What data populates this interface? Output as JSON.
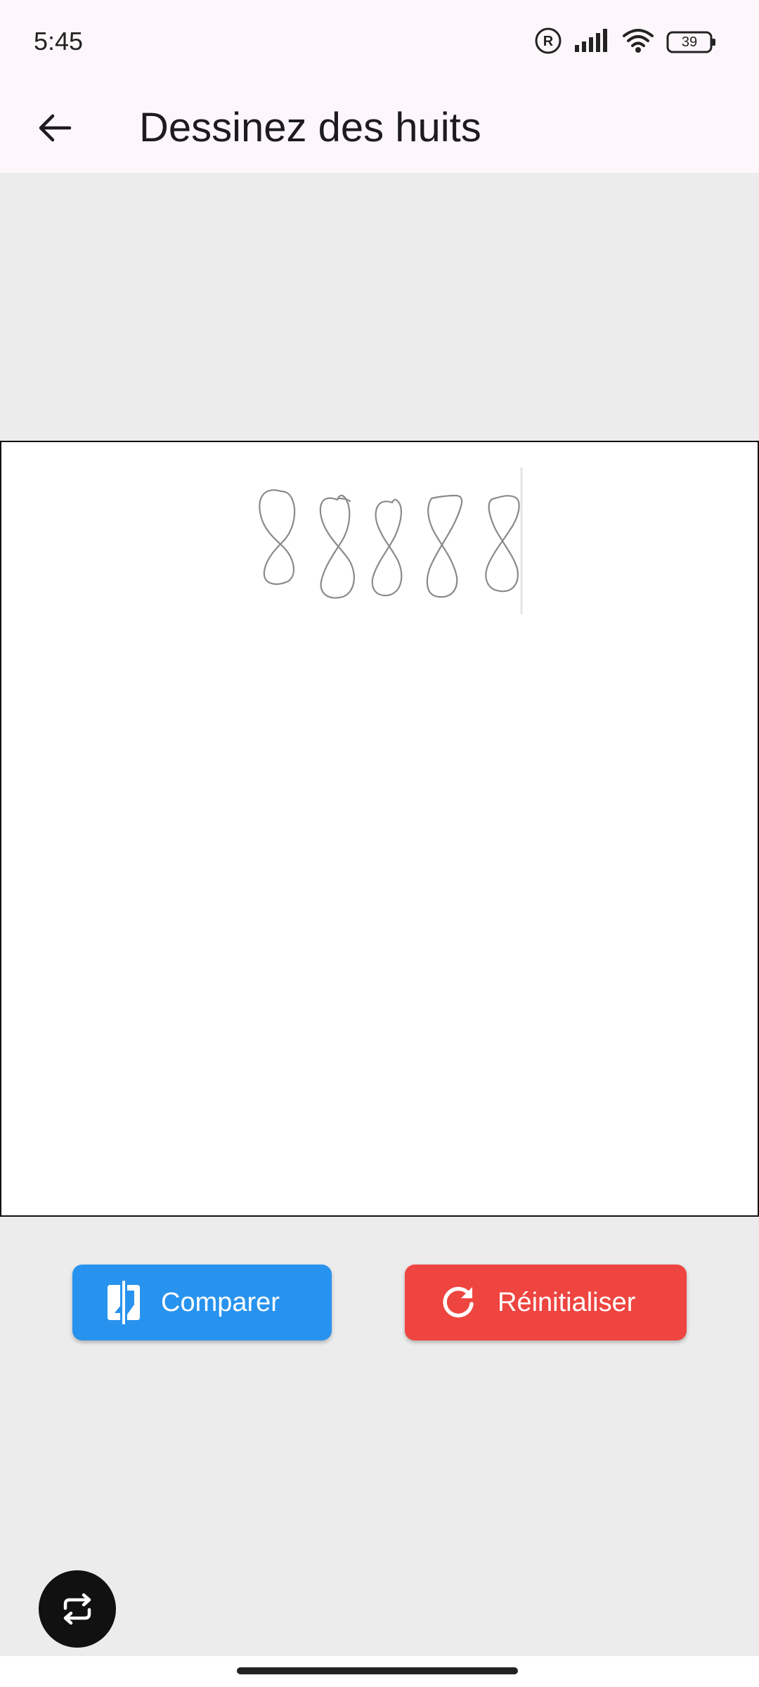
{
  "status_bar": {
    "time": "5:45",
    "battery": "39",
    "icons": [
      "registered-icon",
      "signal-icon",
      "wifi-icon",
      "battery-icon"
    ]
  },
  "app_bar": {
    "title": "Dessinez des huits",
    "back_icon": "arrow-back-icon"
  },
  "canvas": {
    "background": "#ffffff",
    "border": "#111111",
    "drawing": "five handwritten figure-eight strokes"
  },
  "buttons": {
    "compare": {
      "label": "Comparer",
      "icon": "compare-icon",
      "color": "#2893ee"
    },
    "reset": {
      "label": "Réinitialiser",
      "icon": "refresh-icon",
      "color": "#ee4540"
    }
  },
  "fab": {
    "icon": "repeat-icon",
    "color": "#111111"
  },
  "colors": {
    "background": "#ececec",
    "app_bar": "#fdf7fb"
  }
}
